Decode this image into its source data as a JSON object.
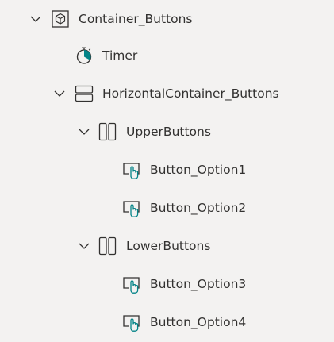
{
  "tree": {
    "nodes": [
      {
        "label": "Container_Buttons",
        "icon": "container-icon",
        "expanded": true
      },
      {
        "label": "Timer",
        "icon": "timer-icon"
      },
      {
        "label": "HorizontalContainer_Buttons",
        "icon": "horizontal-container-icon",
        "expanded": true
      },
      {
        "label": "UpperButtons",
        "icon": "vertical-container-icon",
        "expanded": true
      },
      {
        "label": "Button_Option1",
        "icon": "button-icon"
      },
      {
        "label": "Button_Option2",
        "icon": "button-icon"
      },
      {
        "label": "LowerButtons",
        "icon": "vertical-container-icon",
        "expanded": true
      },
      {
        "label": "Button_Option3",
        "icon": "button-icon"
      },
      {
        "label": "Button_Option4",
        "icon": "button-icon"
      }
    ]
  },
  "colors": {
    "background": "#f3f2f1",
    "text": "#323130",
    "icon": "#323130",
    "accent": "#038387"
  }
}
